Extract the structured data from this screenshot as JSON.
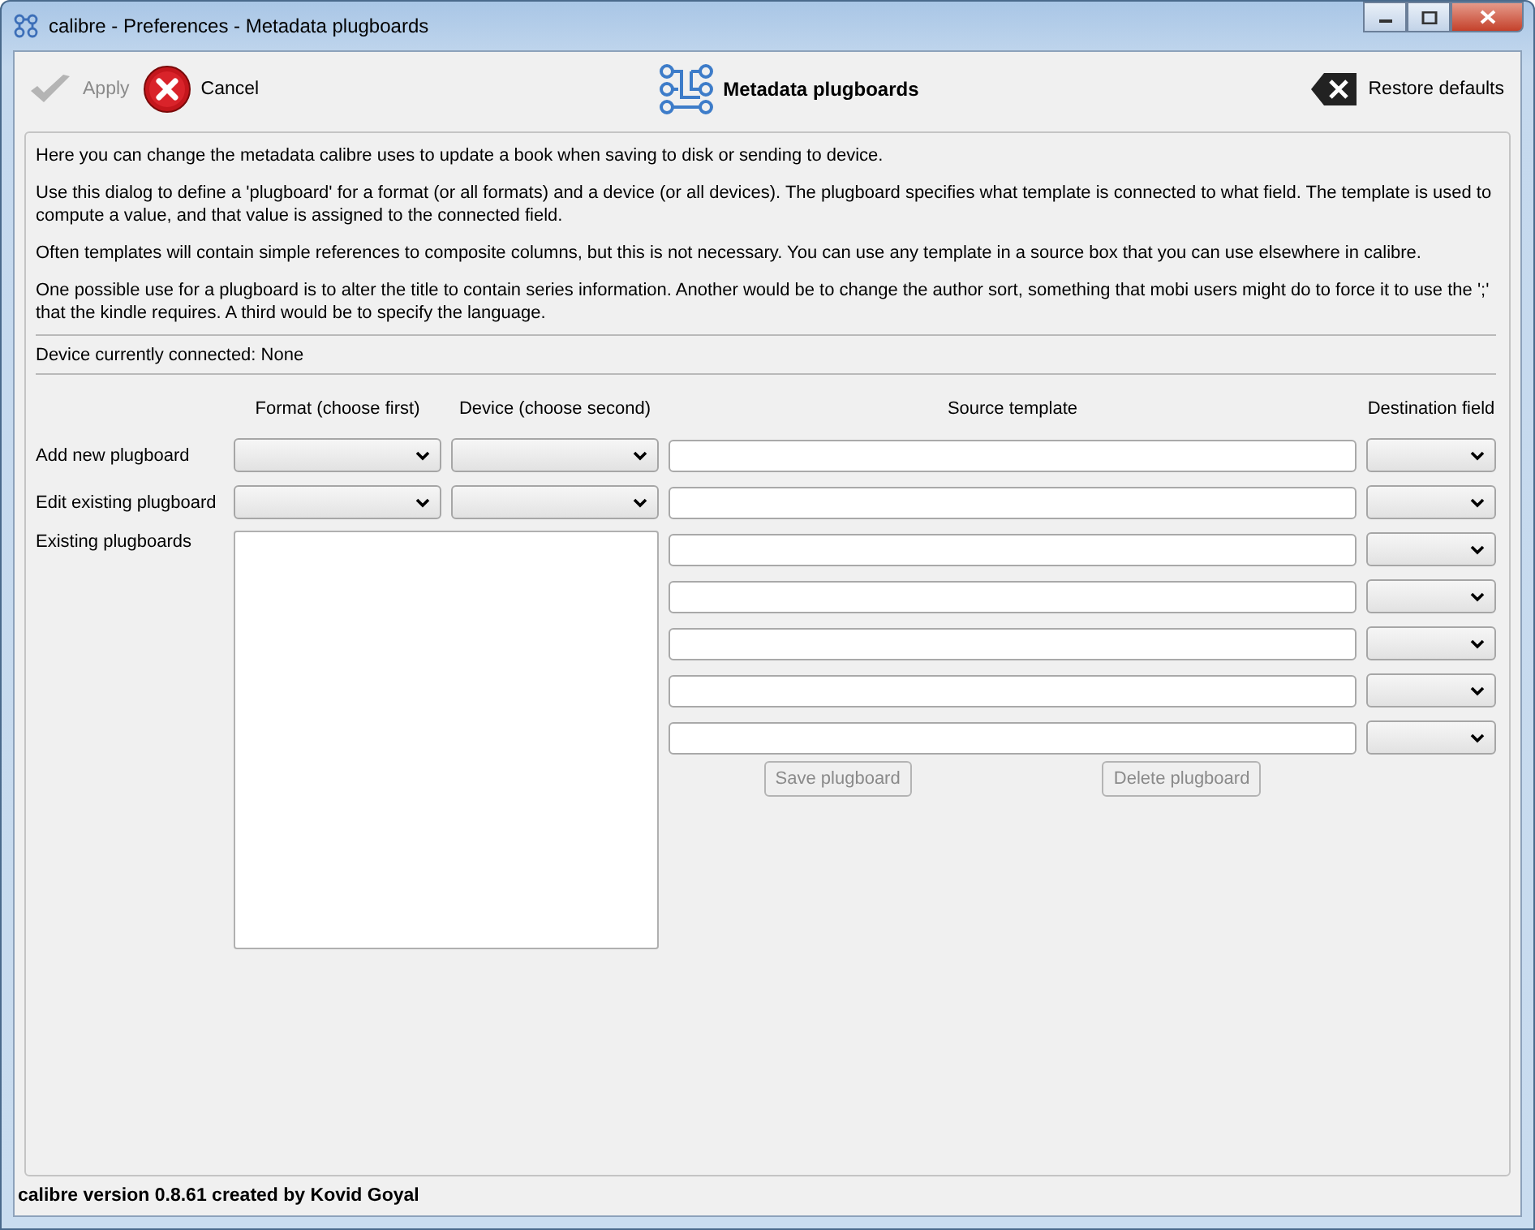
{
  "window": {
    "title": "calibre - Preferences - Metadata plugboards"
  },
  "toolbar": {
    "apply": {
      "label": "Apply",
      "disabled": true
    },
    "cancel": {
      "label": "Cancel"
    },
    "title": "Metadata plugboards",
    "restore": {
      "label": "Restore defaults"
    }
  },
  "intro": [
    "Here you can change the metadata calibre uses to update a book when saving to disk or sending to device.",
    "Use this dialog to define a 'plugboard' for a format (or all formats) and a device (or all devices). The plugboard specifies what template is connected to what field. The template is used to compute a value, and that value is assigned to the connected field.",
    "Often templates will contain simple references to composite columns, but this is not necessary. You can use any template in a source box that you can use elsewhere in calibre.",
    "One possible use for a plugboard is to alter the title to contain series information. Another would be to change the author sort, something that mobi users might do to force it to use the ';' that the kindle requires. A third would be to specify the language."
  ],
  "device_status": "Device currently connected: None",
  "columns": [
    "Format (choose first)",
    "Device (choose second)",
    "Source template",
    "Destination field"
  ],
  "rows": [
    {
      "label": "Add new plugboard"
    },
    {
      "label": "Edit existing plugboard"
    }
  ],
  "existing_label": "Existing plugboards",
  "buttons": [
    {
      "label": "Save plugboard",
      "disabled": true
    },
    {
      "label": "Delete plugboard",
      "disabled": true
    }
  ],
  "status_bar": "calibre version 0.8.61 created by Kovid Goyal"
}
